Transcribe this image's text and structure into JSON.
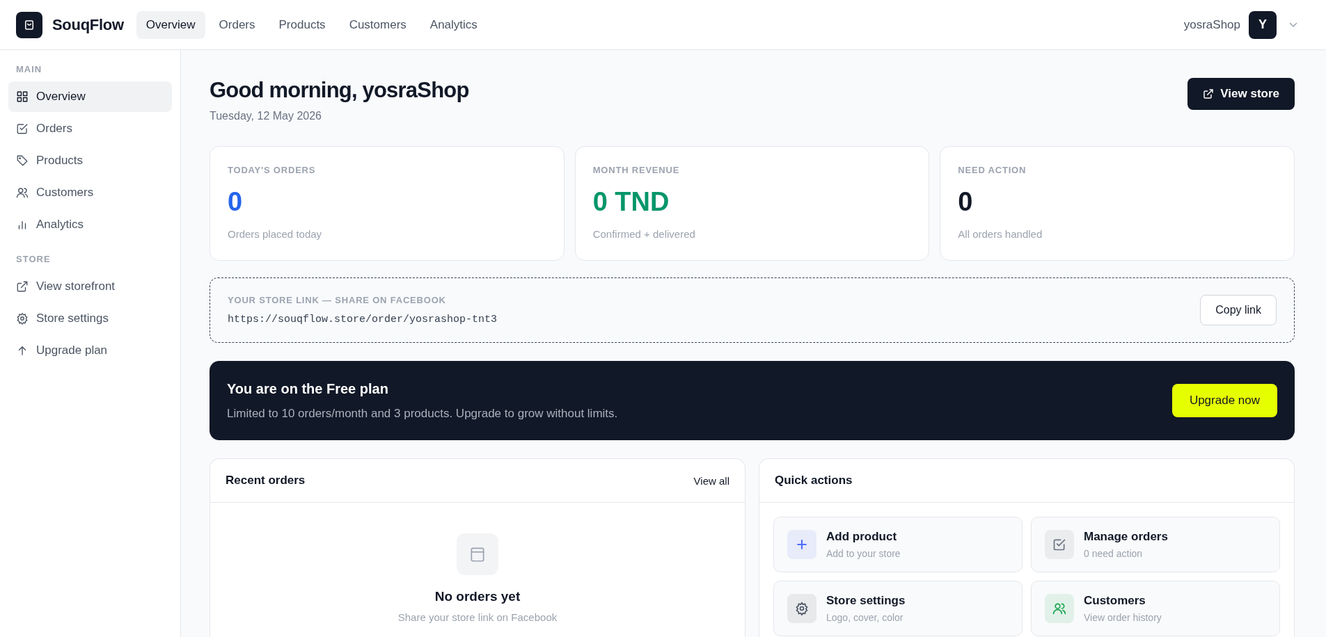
{
  "brand": {
    "name": "SouqFlow"
  },
  "top_nav": [
    {
      "label": "Overview",
      "selected": true
    },
    {
      "label": "Orders",
      "selected": false
    },
    {
      "label": "Products",
      "selected": false
    },
    {
      "label": "Customers",
      "selected": false
    },
    {
      "label": "Analytics",
      "selected": false
    }
  ],
  "user": {
    "name": "yosraShop",
    "initial": "Y"
  },
  "sidebar": {
    "sections": [
      {
        "title": "MAIN",
        "items": [
          {
            "label": "Overview",
            "kind": "grid",
            "selected": true
          },
          {
            "label": "Orders",
            "kind": "check",
            "selected": false
          },
          {
            "label": "Products",
            "kind": "tag",
            "selected": false
          },
          {
            "label": "Customers",
            "kind": "users",
            "selected": false
          },
          {
            "label": "Analytics",
            "kind": "chart",
            "selected": false
          }
        ]
      },
      {
        "title": "STORE",
        "items": [
          {
            "label": "View storefront",
            "kind": "external",
            "selected": false
          },
          {
            "label": "Store settings",
            "kind": "gear",
            "selected": false
          },
          {
            "label": "Upgrade plan",
            "kind": "arrow",
            "selected": false
          }
        ]
      }
    ]
  },
  "greeting": {
    "title": "Good morning, yosraShop",
    "date": "Tuesday, 12 May 2026",
    "button": "View store"
  },
  "stats": [
    {
      "label": "TODAY'S ORDERS",
      "value": "0",
      "caption": "Orders placed today",
      "color": "#2563eb"
    },
    {
      "label": "MONTH REVENUE",
      "value": "0 TND",
      "caption": "Confirmed + delivered",
      "color": "#059669"
    },
    {
      "label": "NEED ACTION",
      "value": "0",
      "caption": "All orders handled",
      "color": "#111827"
    }
  ],
  "store_link": {
    "label": "YOUR STORE LINK — SHARE ON FACEBOOK",
    "url": "https://souqflow.store/order/yosrashop-tnt3",
    "button": "Copy link"
  },
  "plan_banner": {
    "title": "You are on the Free plan",
    "text": "Limited to 10 orders/month and 3 products. Upgrade to grow without limits.",
    "button": "Upgrade now"
  },
  "recent_orders": {
    "title": "Recent orders",
    "link": "View all",
    "empty_title": "No orders yet",
    "empty_text": "Share your store link on Facebook"
  },
  "quick_actions": {
    "title": "Quick actions",
    "items": [
      {
        "kind": "plus",
        "title": "Add product",
        "subtitle": "Add to your store",
        "color": "#4f6ef7"
      },
      {
        "kind": "check",
        "title": "Manage orders",
        "subtitle": "0 need action",
        "color": "#6b7280"
      },
      {
        "kind": "gear",
        "title": "Store settings",
        "subtitle": "Logo, cover, color",
        "color": "#4b5563"
      },
      {
        "kind": "users",
        "title": "Customers",
        "subtitle": "View order history",
        "color": "#16a34a"
      }
    ]
  }
}
